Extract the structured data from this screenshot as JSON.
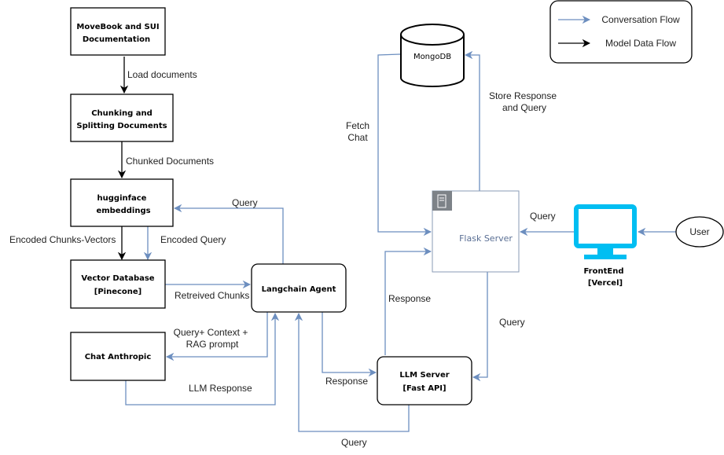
{
  "nodes": {
    "movebook": [
      "MoveBook and SUI",
      "Documentation"
    ],
    "chunking": [
      "Chunking and",
      "Splitting Documents"
    ],
    "embeddings": [
      "hugginface",
      "embeddings"
    ],
    "vectordb": [
      "Vector Database",
      "[Pinecone]"
    ],
    "anthropic": "Chat Anthropic",
    "langchain": "Langchain Agent",
    "llmserver": [
      "LLM Server",
      "[Fast API]"
    ],
    "mongodb": "MongoDB",
    "flask": "Flask Server",
    "frontend": [
      "FrontEnd",
      "[Vercel]"
    ],
    "user": "User"
  },
  "edges": {
    "load": "Load documents",
    "chunked": "Chunked Documents",
    "encoded_chunks": "Encoded Chunks-Vectors",
    "encoded_query": "Encoded Query",
    "query_embed": "Query",
    "retrieved": "Retreived Chunks",
    "rag": [
      "Query+ Context +",
      "RAG prompt"
    ],
    "llm_response": "LLM Response",
    "response_llm": "Response",
    "query_loop": "Query",
    "response_flask": "Response",
    "query_flask_llm": "Query",
    "fetch": [
      "Fetch",
      "Chat"
    ],
    "store": [
      "Store Response",
      "and Query"
    ],
    "query_frontend": "Query"
  },
  "legend": {
    "conversation": "Conversation Flow",
    "model": "Model Data Flow"
  },
  "colors": {
    "conversation": "#6c8ebf",
    "model": "#000000",
    "monitor": "#00bef2",
    "server_icon": "#7d8288"
  }
}
